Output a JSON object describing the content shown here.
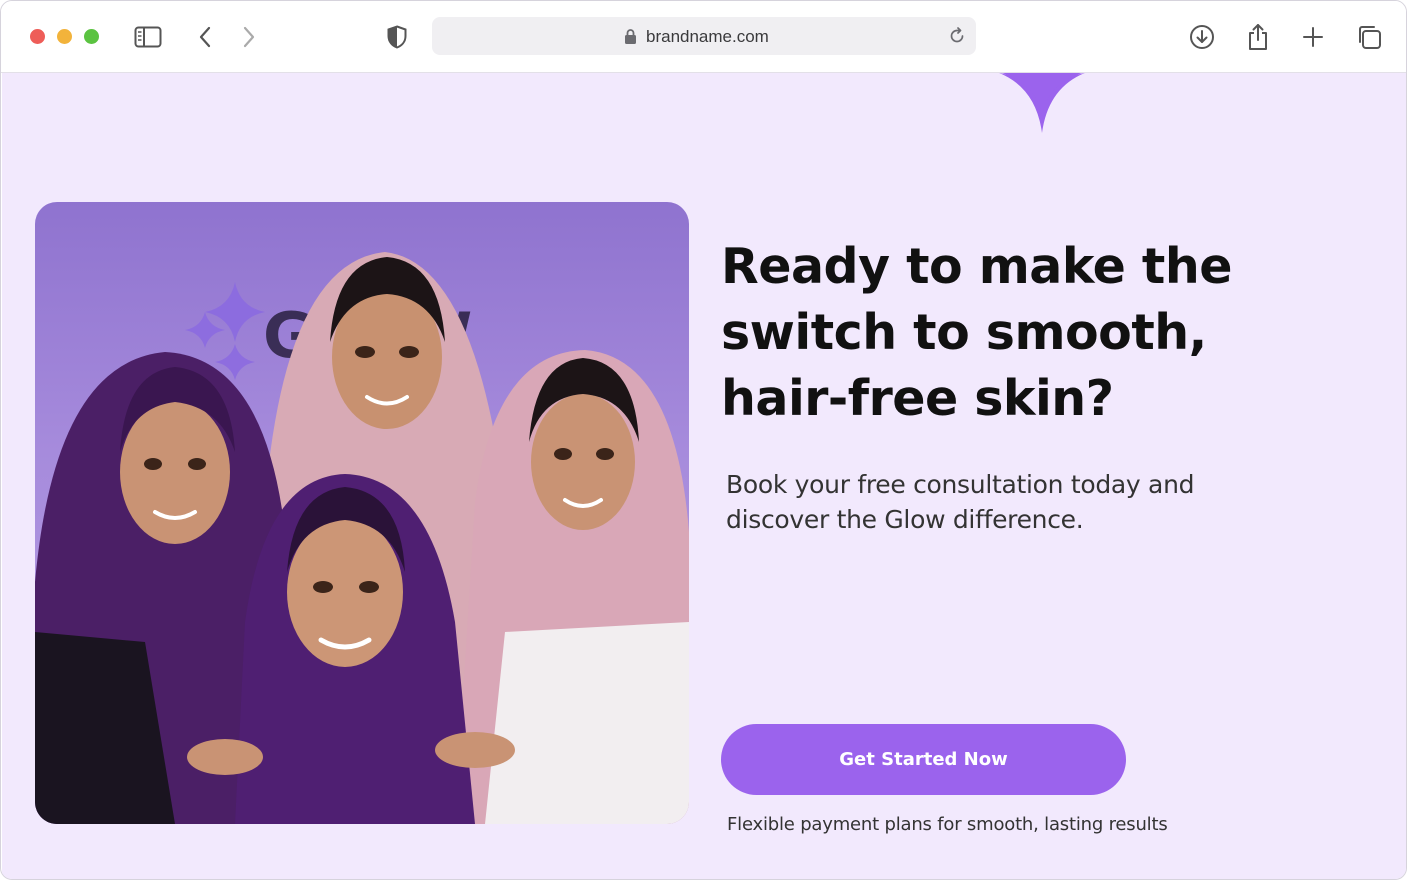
{
  "browser": {
    "url": "brandname.com",
    "icons": {
      "sidebar": "sidebar-icon",
      "back": "chevron-left-icon",
      "forward": "chevron-right-icon",
      "privacy": "shield-icon",
      "lock": "lock-icon",
      "reload": "reload-icon",
      "download": "download-icon",
      "share": "share-icon",
      "new_tab": "plus-icon",
      "tabs": "tabs-overview-icon"
    }
  },
  "hero": {
    "image_logo_text": "GLOW",
    "headline": "Ready to make the switch to smooth, hair-free skin?",
    "subtext": "Book your free consultation today and discover the Glow difference.",
    "cta_label": "Get Started Now",
    "note": "Flexible payment plans for smooth, lasting results"
  },
  "colors": {
    "page_bg": "#f2e9fd",
    "accent": "#9b63ed",
    "sparkle": "#9b63ed"
  }
}
